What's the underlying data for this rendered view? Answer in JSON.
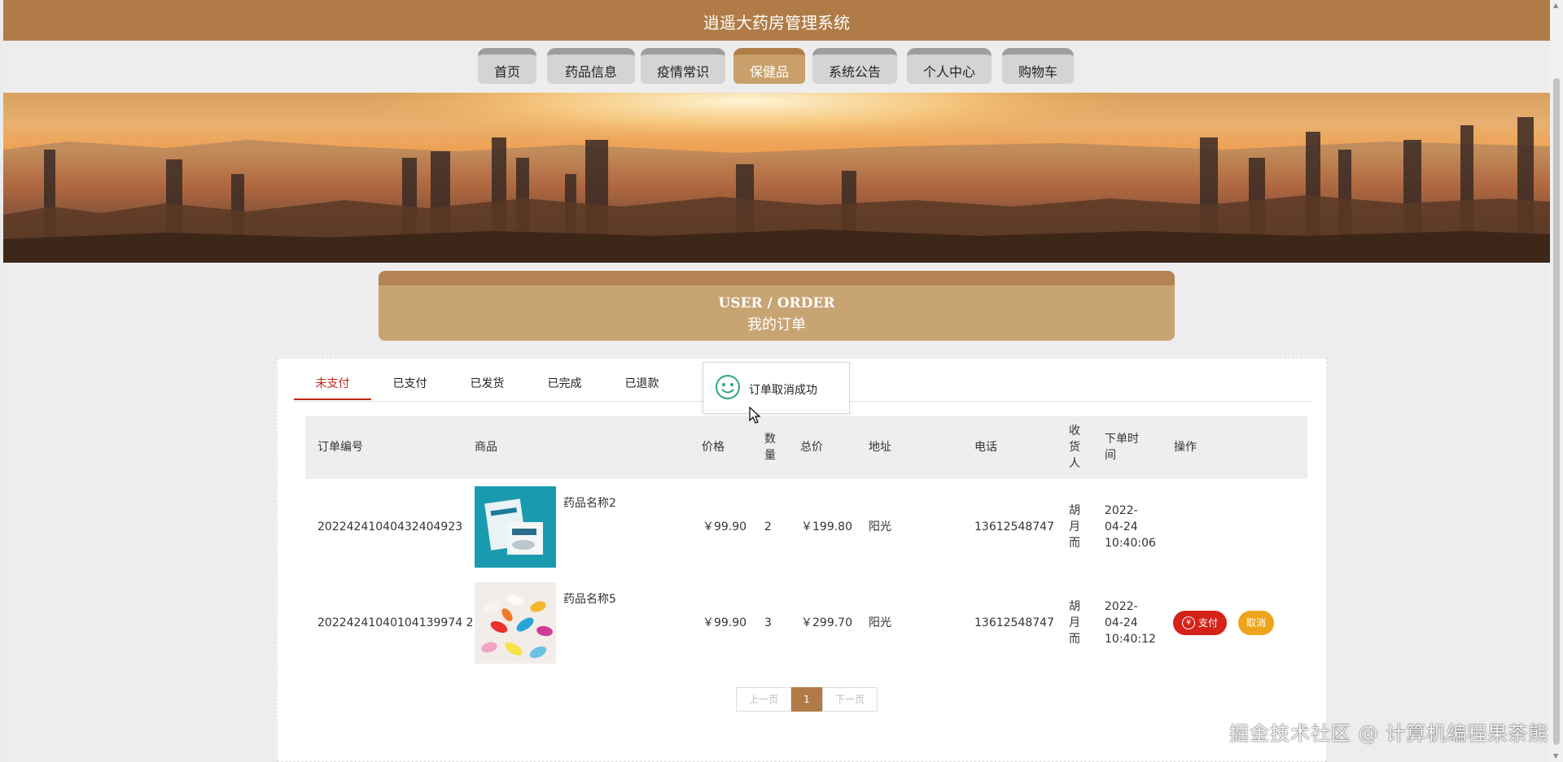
{
  "app": {
    "title": "逍遥大药房管理系统"
  },
  "nav": {
    "items": [
      {
        "label": "首页"
      },
      {
        "label": "药品信息"
      },
      {
        "label": "疫情常识"
      },
      {
        "label": "保健品"
      },
      {
        "label": "系统公告"
      },
      {
        "label": "个人中心"
      },
      {
        "label": "购物车"
      }
    ],
    "active": "保健品"
  },
  "section": {
    "title_en": "USER / ORDER",
    "title_zh": "我的订单"
  },
  "tabs": [
    {
      "label": "未支付",
      "active": true
    },
    {
      "label": "已支付"
    },
    {
      "label": "已发货"
    },
    {
      "label": "已完成"
    },
    {
      "label": "已退款"
    }
  ],
  "toast": {
    "message": "订单取消成功",
    "icon": "smile-icon"
  },
  "table": {
    "headers": {
      "order_no": "订单编号",
      "product": "商品",
      "price": "价格",
      "qty": [
        "数",
        "量"
      ],
      "total": "总价",
      "address": "地址",
      "phone": "电话",
      "receiver": [
        "收",
        "货",
        "人"
      ],
      "time": [
        "下单时",
        "间"
      ],
      "actions": "操作"
    },
    "rows": [
      {
        "order_no": "20224241040432404923",
        "product_name": "药品名称2",
        "price": "￥99.90",
        "qty": "2",
        "total": "￥199.80",
        "address": "阳光",
        "phone": "13612548747",
        "receiver": [
          "胡",
          "月",
          "而"
        ],
        "time": [
          "2022-",
          "04-24",
          "10:40:06"
        ],
        "actions": []
      },
      {
        "order_no": "20224241040104139974 2",
        "product_name": "药品名称5",
        "price": "￥99.90",
        "qty": "3",
        "total": "￥299.70",
        "address": "阳光",
        "phone": "13612548747",
        "receiver": [
          "胡",
          "月",
          "而"
        ],
        "time": [
          "2022-",
          "04-24",
          "10:40:12"
        ],
        "actions": [
          "支付",
          "取消"
        ]
      }
    ]
  },
  "pager": {
    "prev": "上一页",
    "current": "1",
    "next": "下一页"
  },
  "watermark": "掘金技术社区 @ 计算机编程果茶熊",
  "colors": {
    "brand": "#b07b46",
    "active_tab": "#c02818",
    "pay": "#d5231a",
    "cancel": "#eda51b"
  }
}
